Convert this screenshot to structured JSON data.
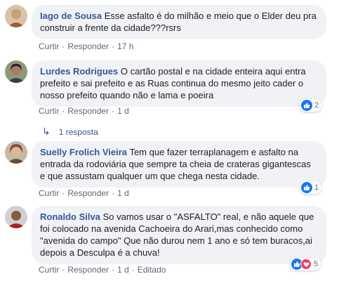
{
  "comments": [
    {
      "author": "Iago de Sousa",
      "text": "Esse asfalto é do milhão e meio que o Elder deu pra construir a frente da cidade???rsrs",
      "like_label": "Curtir",
      "reply_label": "Responder",
      "time": "17 h",
      "avatar_color": "#c9a07a"
    },
    {
      "author": "Lurdes Rodrigues",
      "text": "O cartão postal e na cidade enteira aqui entra prefeito e sai prefeito e as Ruas continua do mesmo jeito cader o nosso prefeito quando não e lama e poeira",
      "like_label": "Curtir",
      "reply_label": "Responder",
      "time": "1 d",
      "reaction_count": "2",
      "replies_label": "1 resposta",
      "avatar_color": "#7a6a5a"
    },
    {
      "author": "Suelly Frolich Vieira",
      "text": "Tem que fazer terraplanagem e asfalto na entrada da rodoviária que sempre ta cheia de crateras gigantescas e que assustam qualquer um que chega nesta cidade.",
      "like_label": "Curtir",
      "reply_label": "Responder",
      "time": "1 d",
      "reaction_count": "1",
      "avatar_color": "#b58a6e"
    },
    {
      "author": "Ronaldo Silva",
      "text": "So vamos usar o \"ASFALTO\" real, e não aquele que foi colocado na avenida Cachoeira do Arari,mas conhecido como \"avenida do campo\" Que não durou nem 1 ano e só tem buracos,ai depois a Desculpa é a chuva!",
      "like_label": "Curtir",
      "reply_label": "Responder",
      "time": "1 d",
      "edited_label": "Editado",
      "reaction_count": "5",
      "avatar_color": "#5a4a44"
    }
  ]
}
